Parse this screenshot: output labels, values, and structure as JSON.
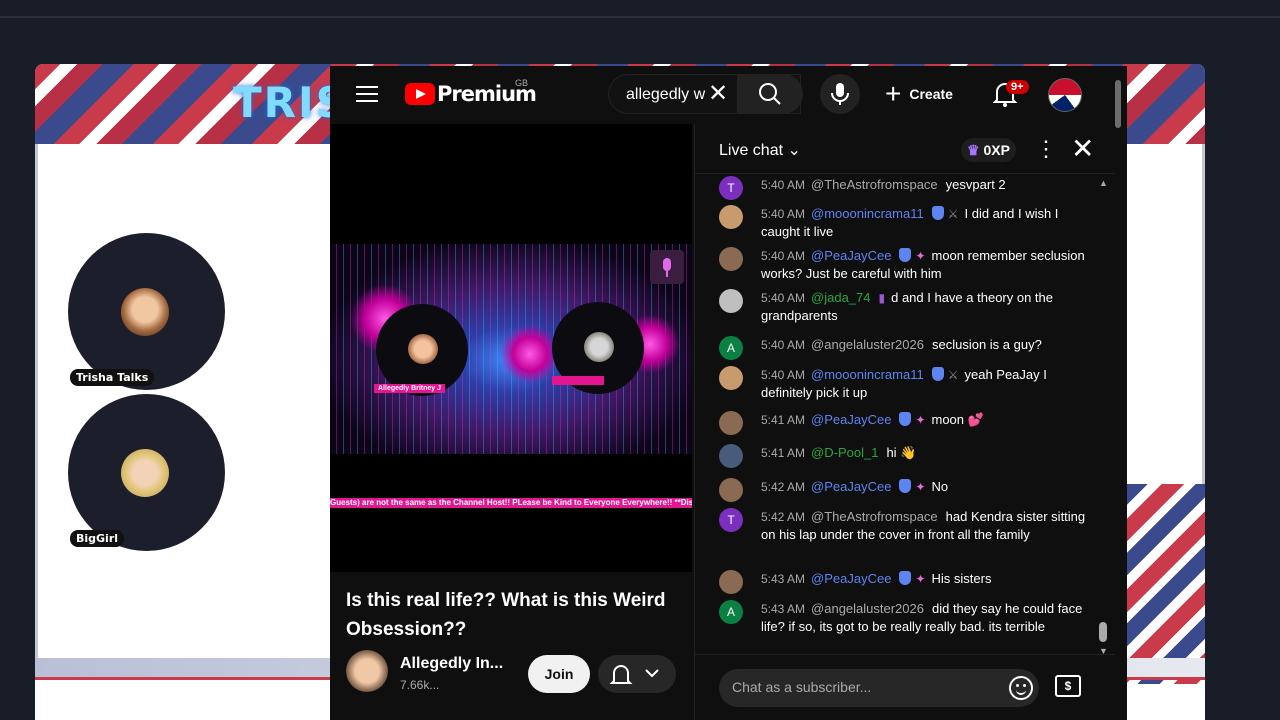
{
  "stream": {
    "banner_title": "TRIS",
    "cams": [
      {
        "label": "Trisha Talks"
      },
      {
        "label": "BigGirl"
      }
    ]
  },
  "header": {
    "brand": "Premium",
    "region": "GB",
    "search_value": "allegedly w",
    "create_label": "Create",
    "notifications_badge": "9+"
  },
  "video": {
    "guest1_tag": "Allegedly Britney J",
    "ticker": "Guests) are not the same as the Channel Host!! PLease be Kind to Everyone Everywhere!! **Disclaim",
    "title": "Is this real life?? What is this Weird Obsession??",
    "channel_name": "Allegedly In...",
    "channel_subs": "7.66k...",
    "join_label": "Join"
  },
  "chat": {
    "title": "Live chat",
    "xp": "0XP",
    "input_placeholder": "Chat as a subscriber...",
    "messages": [
      {
        "avatar": "T",
        "avatar_color": "#7b2fbe",
        "time": "5:40 AM",
        "author": "@TheAstrofromspace",
        "text": "yesvpart 2",
        "member": false
      },
      {
        "avatar": "",
        "avatar_color": "#c79b6e",
        "time": "5:40 AM",
        "author": "@mooonincrama11",
        "text": "I did and I wish I caught it live",
        "member": true
      },
      {
        "avatar": "",
        "avatar_color": "#8a6a52",
        "time": "5:40 AM",
        "author": "@PeaJayCee",
        "text": "moon remember seclusion works? Just be careful with him",
        "member": true
      },
      {
        "avatar": "",
        "avatar_color": "#bfbfbf",
        "time": "5:40 AM",
        "author": "@jada_74",
        "text": "d and I have a theory on the grandparents",
        "member": "green"
      },
      {
        "avatar": "A",
        "avatar_color": "#0b8043",
        "time": "5:40 AM",
        "author": "@angelaluster2026",
        "text": "seclusion is a guy?",
        "member": false
      },
      {
        "avatar": "",
        "avatar_color": "#c79b6e",
        "time": "5:40 AM",
        "author": "@mooonincrama11",
        "text": "yeah PeaJay I definitely pick it up",
        "member": true
      },
      {
        "avatar": "",
        "avatar_color": "#8a6a52",
        "time": "5:41 AM",
        "author": "@PeaJayCee",
        "text": "moon 💕",
        "member": true
      },
      {
        "avatar": "",
        "avatar_color": "#4a5a7a",
        "time": "5:41 AM",
        "author": "@D-Pool_1",
        "text": "hi 👋",
        "member": "green"
      },
      {
        "avatar": "",
        "avatar_color": "#8a6a52",
        "time": "5:42 AM",
        "author": "@PeaJayCee",
        "text": "No",
        "member": true
      },
      {
        "avatar": "T",
        "avatar_color": "#7b2fbe",
        "time": "5:42 AM",
        "author": "@TheAstrofromspace",
        "text": "had Kendra sister sitting on his lap under the cover in front all the family",
        "member": false
      },
      {
        "avatar": "",
        "avatar_color": "#8a6a52",
        "time": "5:43 AM",
        "author": "@PeaJayCee",
        "text": "His sisters",
        "member": true
      },
      {
        "avatar": "A",
        "avatar_color": "#0b8043",
        "time": "5:43 AM",
        "author": "@angelaluster2026",
        "text": "did they say he could face life? if so, its got to be really really bad. its terrible",
        "member": false
      }
    ]
  }
}
